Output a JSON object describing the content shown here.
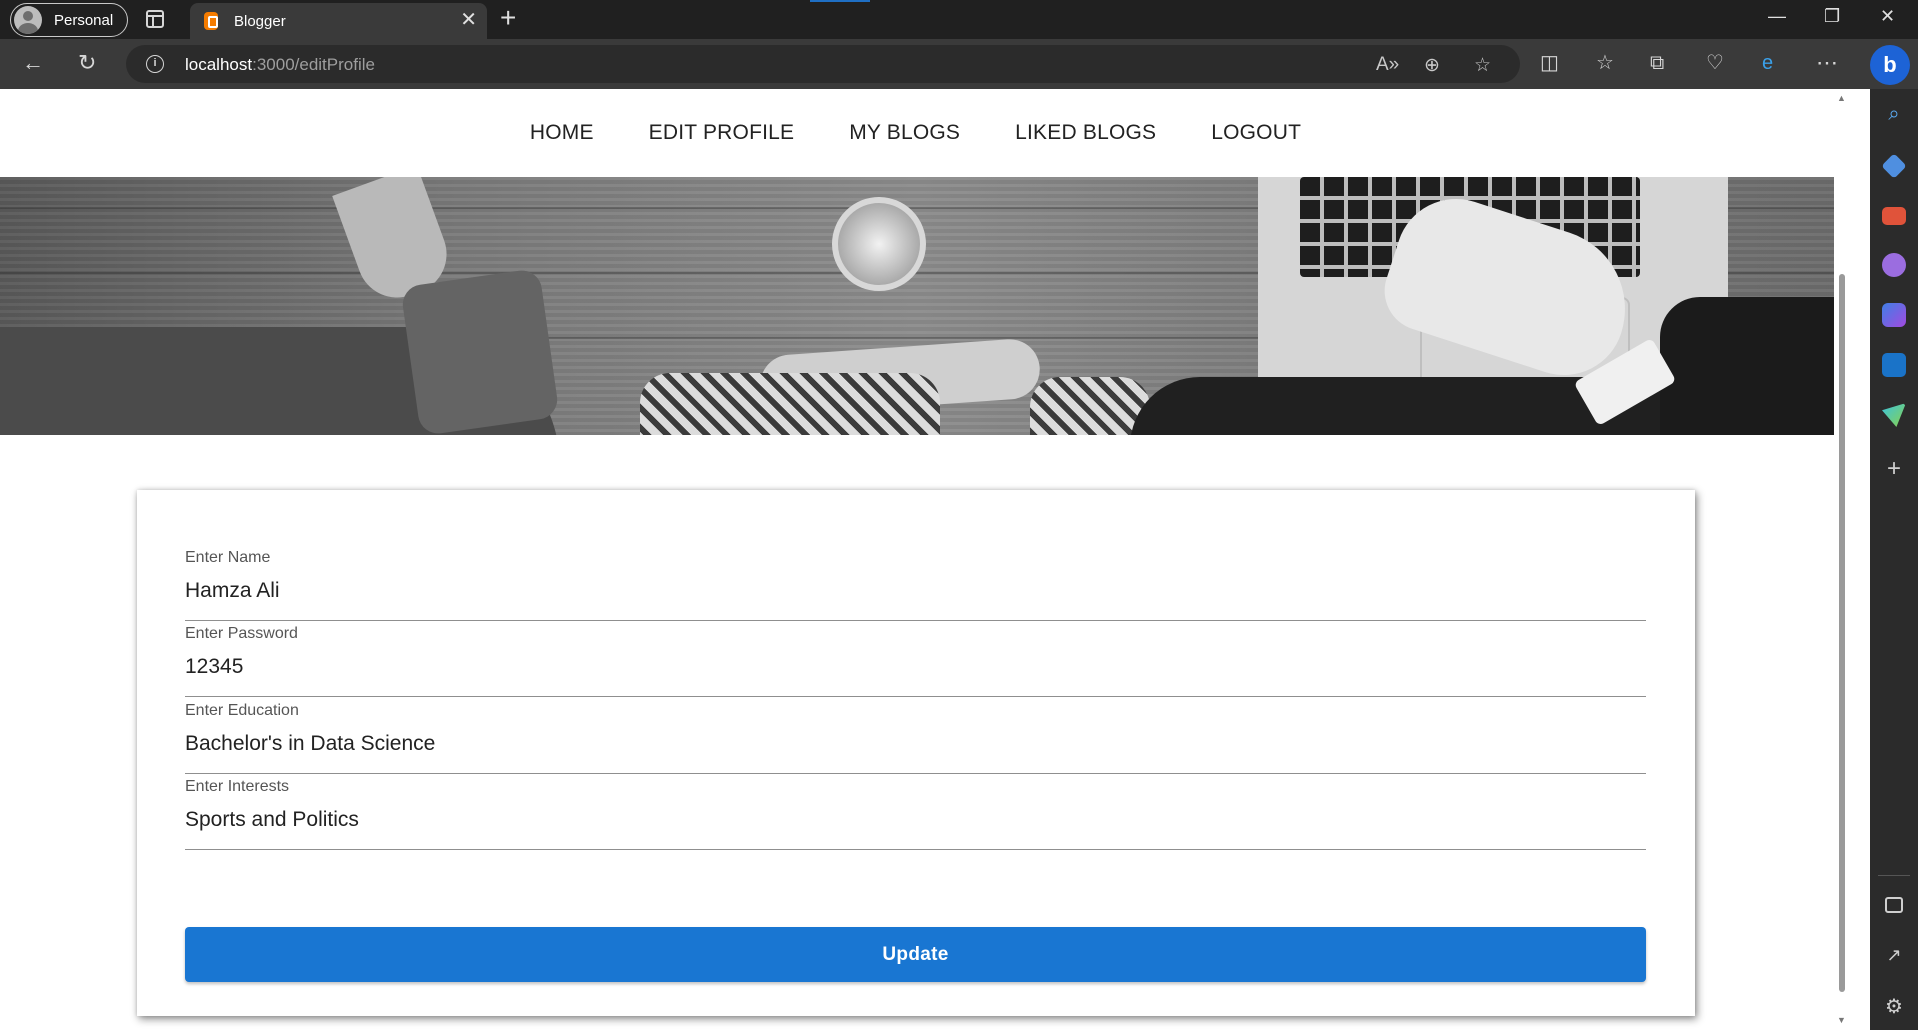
{
  "browser": {
    "profile_label": "Personal",
    "tab_title": "Blogger",
    "url_host": "localhost",
    "url_path": ":3000/editProfile"
  },
  "site": {
    "nav": [
      "HOME",
      "EDIT PROFILE",
      "MY BLOGS",
      "LIKED BLOGS",
      "LOGOUT"
    ]
  },
  "form": {
    "fields": [
      {
        "label": "Enter Name",
        "value": "Hamza Ali"
      },
      {
        "label": "Enter Password",
        "value": "12345"
      },
      {
        "label": "Enter Education",
        "value": "Bachelor's in Data Science"
      },
      {
        "label": "Enter Interests",
        "value": "Sports and Politics"
      }
    ],
    "submit_label": "Update"
  },
  "colors": {
    "primary_button": "#1976d2",
    "browser_tab_bar": "#202020",
    "browser_toolbar": "#3a3a3a"
  },
  "icons": {
    "tab": "blogger-icon",
    "toolbar": [
      "back-arrow-icon",
      "refresh-icon",
      "info-icon",
      "read-aloud-icon",
      "zoom-icon",
      "favorite-star-icon",
      "split-screen-icon",
      "favorites-icon",
      "collections-icon",
      "browser-essentials-icon",
      "edge-icon",
      "more-icon",
      "bing-chat-icon"
    ],
    "sidebar": [
      "search-icon",
      "shopping-icon",
      "tools-icon",
      "games-icon",
      "copilot-icon",
      "outlook-icon",
      "send-icon",
      "add-icon",
      "sidebar-layout-icon",
      "external-link-icon",
      "settings-icon"
    ]
  }
}
